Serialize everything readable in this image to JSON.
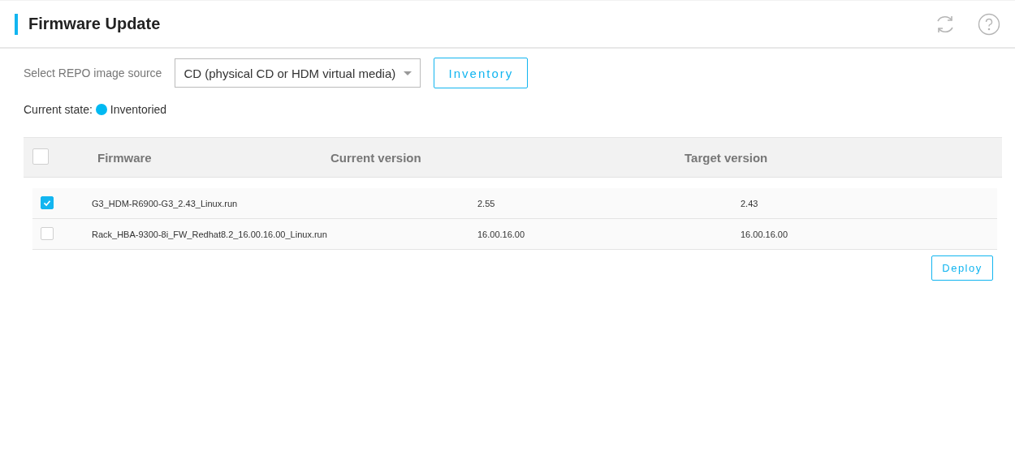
{
  "header": {
    "title": "Firmware Update"
  },
  "source": {
    "label": "Select REPO image source",
    "value": "CD (physical CD or HDM virtual media)",
    "button": "Inventory"
  },
  "state": {
    "label": "Current state:",
    "value": "Inventoried",
    "color": "#00b9f2"
  },
  "table": {
    "select_all_checked": false,
    "columns": [
      "Firmware",
      "Current version",
      "Target version"
    ],
    "rows": [
      {
        "checked": true,
        "firmware": "G3_HDM-R6900-G3_2.43_Linux.run",
        "current": "2.55",
        "target": "2.43"
      },
      {
        "checked": false,
        "firmware": "Rack_HBA-9300-8i_FW_Redhat8.2_16.00.16.00_Linux.run",
        "current": "16.00.16.00",
        "target": "16.00.16.00"
      }
    ]
  },
  "deploy_button": "Deploy"
}
